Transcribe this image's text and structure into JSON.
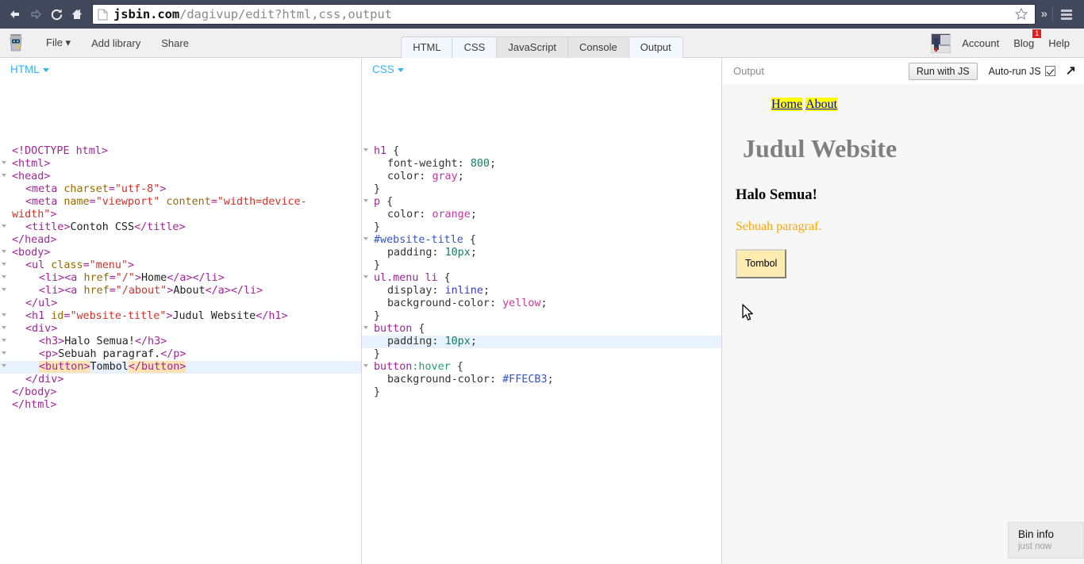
{
  "browser": {
    "url_prefix": "jsbin.com",
    "url_suffix": "/dagivup/edit?html,css,output",
    "back_icon": "back-arrow-icon",
    "forward_icon": "forward-arrow-icon",
    "reload_icon": "reload-icon",
    "home_icon": "home-icon",
    "star_icon": "bookmark-star-icon",
    "overflow_label": "»",
    "menu_icon": "hamburger-menu-icon",
    "chrome_bg": "#41485c"
  },
  "toolbar": {
    "logo": "jsbin-robot-logo",
    "menu": [
      {
        "label": "File ▾",
        "name": "file-menu"
      },
      {
        "label": "Add library",
        "name": "add-library-button"
      },
      {
        "label": "Share",
        "name": "share-button"
      }
    ],
    "tabs": [
      {
        "label": "HTML",
        "active": true
      },
      {
        "label": "CSS",
        "active": true
      },
      {
        "label": "JavaScript",
        "active": false
      },
      {
        "label": "Console",
        "active": false
      },
      {
        "label": "Output",
        "active": true
      }
    ],
    "account_label": "Account",
    "blog_label": "Blog",
    "blog_badge": "1",
    "help_label": "Help",
    "badge_color": "#e02020"
  },
  "html_panel": {
    "label": "HTML",
    "lines": [
      {
        "indent": 0,
        "fold": false,
        "parts": [
          {
            "c": "punc",
            "t": "<!DOCTYPE html>"
          }
        ]
      },
      {
        "indent": 0,
        "fold": true,
        "parts": [
          {
            "c": "tag",
            "t": "<html>"
          }
        ]
      },
      {
        "indent": 0,
        "fold": true,
        "parts": [
          {
            "c": "tag",
            "t": "<head>"
          }
        ]
      },
      {
        "indent": 1,
        "fold": false,
        "parts": [
          {
            "c": "tag",
            "t": "<meta "
          },
          {
            "c": "attr",
            "t": "charset"
          },
          {
            "c": "tag",
            "t": "="
          },
          {
            "c": "str",
            "t": "\"utf-8\""
          },
          {
            "c": "tag",
            "t": ">"
          }
        ]
      },
      {
        "indent": 1,
        "fold": false,
        "wrap": true,
        "parts": [
          {
            "c": "tag",
            "t": "<meta "
          },
          {
            "c": "attr",
            "t": "name"
          },
          {
            "c": "tag",
            "t": "="
          },
          {
            "c": "str",
            "t": "\"viewport\""
          },
          {
            "c": "tag",
            "t": " "
          },
          {
            "c": "attr",
            "t": "content"
          },
          {
            "c": "tag",
            "t": "="
          },
          {
            "c": "str",
            "t": "\"width=device-\nwidth\""
          },
          {
            "c": "tag",
            "t": ">"
          }
        ]
      },
      {
        "indent": 1,
        "fold": true,
        "parts": [
          {
            "c": "tag",
            "t": "<title>"
          },
          {
            "c": "txt",
            "t": "Contoh CSS"
          },
          {
            "c": "tag",
            "t": "</title>"
          }
        ]
      },
      {
        "indent": 0,
        "fold": false,
        "parts": [
          {
            "c": "tag",
            "t": "</head>"
          }
        ]
      },
      {
        "indent": 0,
        "fold": true,
        "parts": [
          {
            "c": "tag",
            "t": "<body>"
          }
        ]
      },
      {
        "indent": 1,
        "fold": true,
        "parts": [
          {
            "c": "tag",
            "t": "<ul "
          },
          {
            "c": "attr",
            "t": "class"
          },
          {
            "c": "tag",
            "t": "="
          },
          {
            "c": "str",
            "t": "\"menu\""
          },
          {
            "c": "tag",
            "t": ">"
          }
        ]
      },
      {
        "indent": 2,
        "fold": true,
        "parts": [
          {
            "c": "tag",
            "t": "<li><a "
          },
          {
            "c": "attr",
            "t": "href"
          },
          {
            "c": "tag",
            "t": "="
          },
          {
            "c": "str",
            "t": "\"/\""
          },
          {
            "c": "tag",
            "t": ">"
          },
          {
            "c": "txt",
            "t": "Home"
          },
          {
            "c": "tag",
            "t": "</a></li>"
          }
        ]
      },
      {
        "indent": 2,
        "fold": true,
        "parts": [
          {
            "c": "tag",
            "t": "<li><a "
          },
          {
            "c": "attr",
            "t": "href"
          },
          {
            "c": "tag",
            "t": "="
          },
          {
            "c": "str",
            "t": "\"/about\""
          },
          {
            "c": "tag",
            "t": ">"
          },
          {
            "c": "txt",
            "t": "About"
          },
          {
            "c": "tag",
            "t": "</a></li>"
          }
        ]
      },
      {
        "indent": 1,
        "fold": false,
        "parts": [
          {
            "c": "tag",
            "t": "</ul>"
          }
        ]
      },
      {
        "indent": 1,
        "fold": true,
        "parts": [
          {
            "c": "tag",
            "t": "<h1 "
          },
          {
            "c": "attr",
            "t": "id"
          },
          {
            "c": "tag",
            "t": "="
          },
          {
            "c": "str",
            "t": "\"website-title\""
          },
          {
            "c": "tag",
            "t": ">"
          },
          {
            "c": "txt",
            "t": "Judul Website"
          },
          {
            "c": "tag",
            "t": "</h1>"
          }
        ]
      },
      {
        "indent": 1,
        "fold": true,
        "parts": [
          {
            "c": "tag",
            "t": "<div>"
          }
        ]
      },
      {
        "indent": 2,
        "fold": true,
        "parts": [
          {
            "c": "tag",
            "t": "<h3>"
          },
          {
            "c": "txt",
            "t": "Halo Semua!"
          },
          {
            "c": "tag",
            "t": "</h3>"
          }
        ]
      },
      {
        "indent": 2,
        "fold": true,
        "parts": [
          {
            "c": "tag",
            "t": "<p>"
          },
          {
            "c": "txt",
            "t": "Sebuah paragraf."
          },
          {
            "c": "tag",
            "t": "</p>"
          }
        ]
      },
      {
        "indent": 2,
        "fold": true,
        "active": true,
        "parts": [
          {
            "c": "tag",
            "t": "<button>",
            "hl": true
          },
          {
            "c": "txt",
            "t": "Tombol"
          },
          {
            "c": "tag",
            "t": "</button>",
            "hl": true
          }
        ]
      },
      {
        "indent": 1,
        "fold": false,
        "parts": [
          {
            "c": "tag",
            "t": "</div>"
          }
        ]
      },
      {
        "indent": 0,
        "fold": false,
        "parts": [
          {
            "c": "tag",
            "t": "</body>"
          }
        ]
      },
      {
        "indent": 0,
        "fold": false,
        "parts": [
          {
            "c": "tag",
            "t": "</html>"
          }
        ]
      }
    ]
  },
  "css_panel": {
    "label": "CSS",
    "lines": [
      {
        "indent": 0,
        "fold": true,
        "parts": [
          {
            "c": "sel",
            "t": "h1"
          },
          {
            "c": "brace",
            "t": " {"
          }
        ]
      },
      {
        "indent": 1,
        "fold": false,
        "parts": [
          {
            "c": "prop",
            "t": "font-weight: "
          },
          {
            "c": "num",
            "t": "800"
          },
          {
            "c": "prop",
            "t": ";"
          }
        ]
      },
      {
        "indent": 1,
        "fold": false,
        "parts": [
          {
            "c": "prop",
            "t": "color: "
          },
          {
            "c": "val",
            "t": "gray"
          },
          {
            "c": "prop",
            "t": ";"
          }
        ]
      },
      {
        "indent": 0,
        "fold": false,
        "parts": [
          {
            "c": "brace",
            "t": "}"
          }
        ]
      },
      {
        "indent": 0,
        "fold": true,
        "parts": [
          {
            "c": "sel",
            "t": "p"
          },
          {
            "c": "brace",
            "t": " {"
          }
        ]
      },
      {
        "indent": 1,
        "fold": false,
        "parts": [
          {
            "c": "prop",
            "t": "color: "
          },
          {
            "c": "val",
            "t": "orange"
          },
          {
            "c": "prop",
            "t": ";"
          }
        ]
      },
      {
        "indent": 0,
        "fold": false,
        "parts": [
          {
            "c": "brace",
            "t": "}"
          }
        ]
      },
      {
        "indent": 0,
        "fold": true,
        "parts": [
          {
            "c": "selid",
            "t": "#website-title"
          },
          {
            "c": "brace",
            "t": " {"
          }
        ]
      },
      {
        "indent": 1,
        "fold": false,
        "parts": [
          {
            "c": "prop",
            "t": "padding: "
          },
          {
            "c": "num",
            "t": "10px"
          },
          {
            "c": "prop",
            "t": ";"
          }
        ]
      },
      {
        "indent": 0,
        "fold": false,
        "parts": [
          {
            "c": "brace",
            "t": "}"
          }
        ]
      },
      {
        "indent": 0,
        "fold": true,
        "parts": [
          {
            "c": "sel",
            "t": "ul.menu li"
          },
          {
            "c": "brace",
            "t": " {"
          }
        ]
      },
      {
        "indent": 1,
        "fold": false,
        "parts": [
          {
            "c": "prop",
            "t": "display: "
          },
          {
            "c": "kw",
            "t": "inline"
          },
          {
            "c": "prop",
            "t": ";"
          }
        ]
      },
      {
        "indent": 1,
        "fold": false,
        "parts": [
          {
            "c": "prop",
            "t": "background-color: "
          },
          {
            "c": "val",
            "t": "yellow"
          },
          {
            "c": "prop",
            "t": ";"
          }
        ]
      },
      {
        "indent": 0,
        "fold": false,
        "parts": [
          {
            "c": "brace",
            "t": "}"
          }
        ]
      },
      {
        "indent": 0,
        "fold": true,
        "parts": [
          {
            "c": "sel",
            "t": "button"
          },
          {
            "c": "brace",
            "t": " {"
          }
        ]
      },
      {
        "indent": 1,
        "fold": false,
        "active": true,
        "parts": [
          {
            "c": "prop",
            "t": "padding: "
          },
          {
            "c": "num",
            "t": "10px"
          },
          {
            "c": "prop",
            "t": ";"
          }
        ]
      },
      {
        "indent": 0,
        "fold": false,
        "parts": [
          {
            "c": "brace",
            "t": "}"
          }
        ]
      },
      {
        "indent": 0,
        "fold": true,
        "parts": [
          {
            "c": "sel",
            "t": "button"
          },
          {
            "c": "pseudo",
            "t": ":hover"
          },
          {
            "c": "brace",
            "t": " {"
          }
        ]
      },
      {
        "indent": 1,
        "fold": false,
        "parts": [
          {
            "c": "prop",
            "t": "background-color: "
          },
          {
            "c": "hex",
            "t": "#FFECB3"
          },
          {
            "c": "prop",
            "t": ";"
          }
        ]
      },
      {
        "indent": 0,
        "fold": false,
        "parts": [
          {
            "c": "brace",
            "t": "}"
          }
        ]
      }
    ]
  },
  "output_panel": {
    "title": "Output",
    "run_button": "Run with JS",
    "autorun_label": "Auto-run JS",
    "autorun_checked": true,
    "expand_icon": "expand-arrow-icon",
    "rendered": {
      "menu": [
        "Home",
        "About"
      ],
      "h1": "Judul Website",
      "h3": "Halo Semua!",
      "p": "Sebuah paragraf.",
      "button": "Tombol",
      "h1_color": "gray",
      "p_color": "orange",
      "menu_bg": "#ffff00",
      "button_bg": "#FFECB3"
    }
  },
  "bin_info": {
    "title": "Bin info",
    "subtitle": "just now"
  }
}
